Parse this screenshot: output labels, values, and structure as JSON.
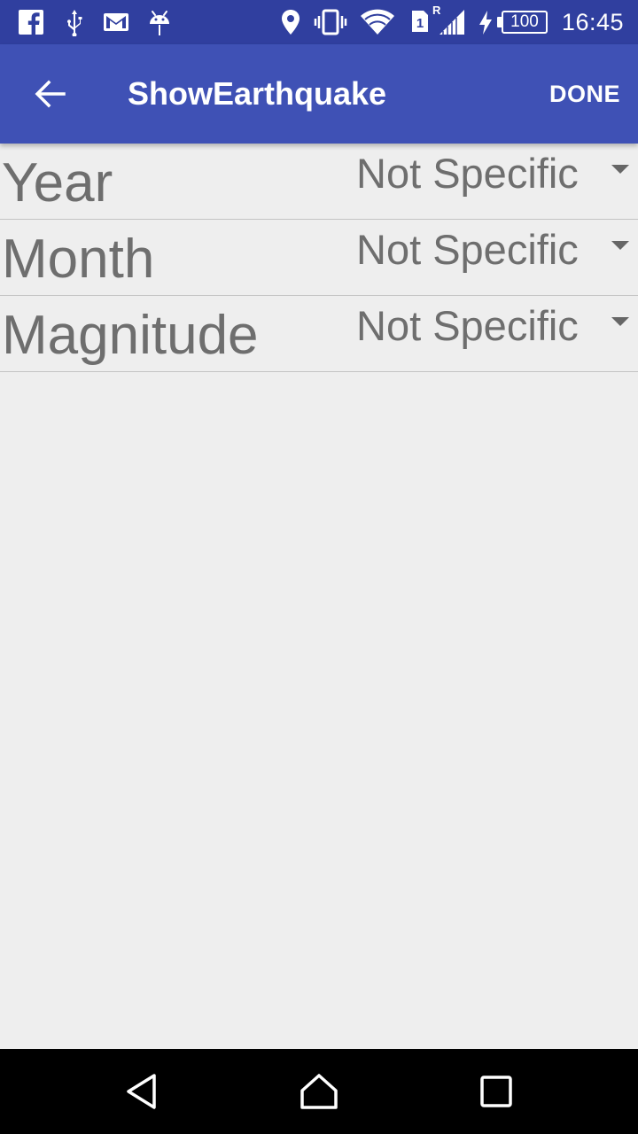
{
  "status_bar": {
    "time": "16:45",
    "battery": "100",
    "roaming_indicator": "R",
    "sim_slot": "1",
    "icons": [
      "facebook-icon",
      "usb-icon",
      "gmail-icon",
      "android-debug-icon",
      "location-icon",
      "vibrate-icon",
      "wifi-icon",
      "sim-icon",
      "cell-signal-icon",
      "charging-icon",
      "battery-icon"
    ]
  },
  "app_bar": {
    "title": "ShowEarthquake",
    "done_label": "DONE",
    "back_icon": "arrow-left-icon",
    "color": "#3f51b5"
  },
  "filters": [
    {
      "label": "Year",
      "value": "Not Specific"
    },
    {
      "label": "Month",
      "value": "Not Specific"
    },
    {
      "label": "Magnitude",
      "value": "Not Specific"
    }
  ],
  "nav_bar": {
    "icons": [
      "back-triangle-icon",
      "home-icon",
      "recents-square-icon"
    ]
  },
  "colors": {
    "status_bar": "#303f9f",
    "primary": "#3f51b5",
    "background": "#eeeeee",
    "text": "#6e6e6e"
  }
}
